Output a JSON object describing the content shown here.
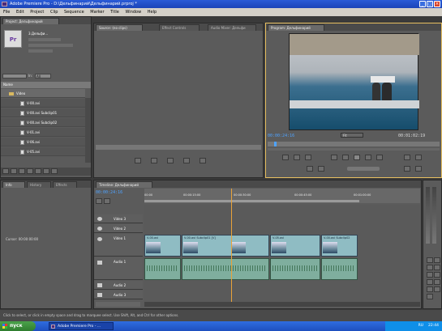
{
  "window": {
    "title": "Adobe Premiere Pro - D:\\Дельфинарий\\Дельфинарий.prproj *"
  },
  "menu": [
    "File",
    "Edit",
    "Project",
    "Clip",
    "Sequence",
    "Marker",
    "Title",
    "Window",
    "Help"
  ],
  "project": {
    "tab": "Project: Дельфинарий",
    "thumb_label": "Pr",
    "clip_name": "3.Дельфи...",
    "search_label": "In:",
    "search_value": "All",
    "table_header_name": "Name",
    "bin": "Video",
    "items": [
      "V-00.avi",
      "V-00.avi Subclip01",
      "V-00.avi Subclip02",
      "V-01.avi",
      "V-06.avi",
      "V-05.avi"
    ]
  },
  "source": {
    "tabs": [
      "Source: (no clips)",
      "Effect Controls",
      "Audio Mixer: Дельфи"
    ]
  },
  "program": {
    "tab": "Program: Дельфинарий",
    "timecode_left": "00:00:24:16",
    "timecode_right": "00:01:02:19",
    "zoom": "Fit"
  },
  "timeline": {
    "tab": "Timeline: Дельфинарий",
    "timecode": "00:00:24:16",
    "ruler": [
      "00:00",
      "00:00:15:00",
      "00:00:30:00",
      "00:00:45:00",
      "00:01:00:00"
    ],
    "tracks": [
      {
        "name": "Video 3",
        "kind": "video"
      },
      {
        "name": "Video 2",
        "kind": "video"
      },
      {
        "name": "Video 1",
        "kind": "video"
      },
      {
        "name": "Audio 1",
        "kind": "audio"
      },
      {
        "name": "Audio 2",
        "kind": "audio"
      },
      {
        "name": "Audio 3",
        "kind": "audio"
      }
    ],
    "clip_labels": [
      "V-00.avi",
      "V-00.avi Subclip01 [V]",
      "V-05.avi",
      "V-00.avi Subclip02"
    ]
  },
  "info": {
    "tabs": [
      "Info",
      "History",
      "Effects"
    ],
    "cursor_label": "Cursor: 00:00:00:00"
  },
  "status": "Click to select, or click in empty space and drag to marquee select. Use Shift, Alt, and Ctrl for other options.",
  "taskbar": {
    "start": "пуск",
    "item": "Adobe Premiere Pro - ...",
    "lang": "RU",
    "clock": "22:44"
  },
  "colors": {
    "accent": "#4fa3ff",
    "playhead": "#e8a33a"
  }
}
